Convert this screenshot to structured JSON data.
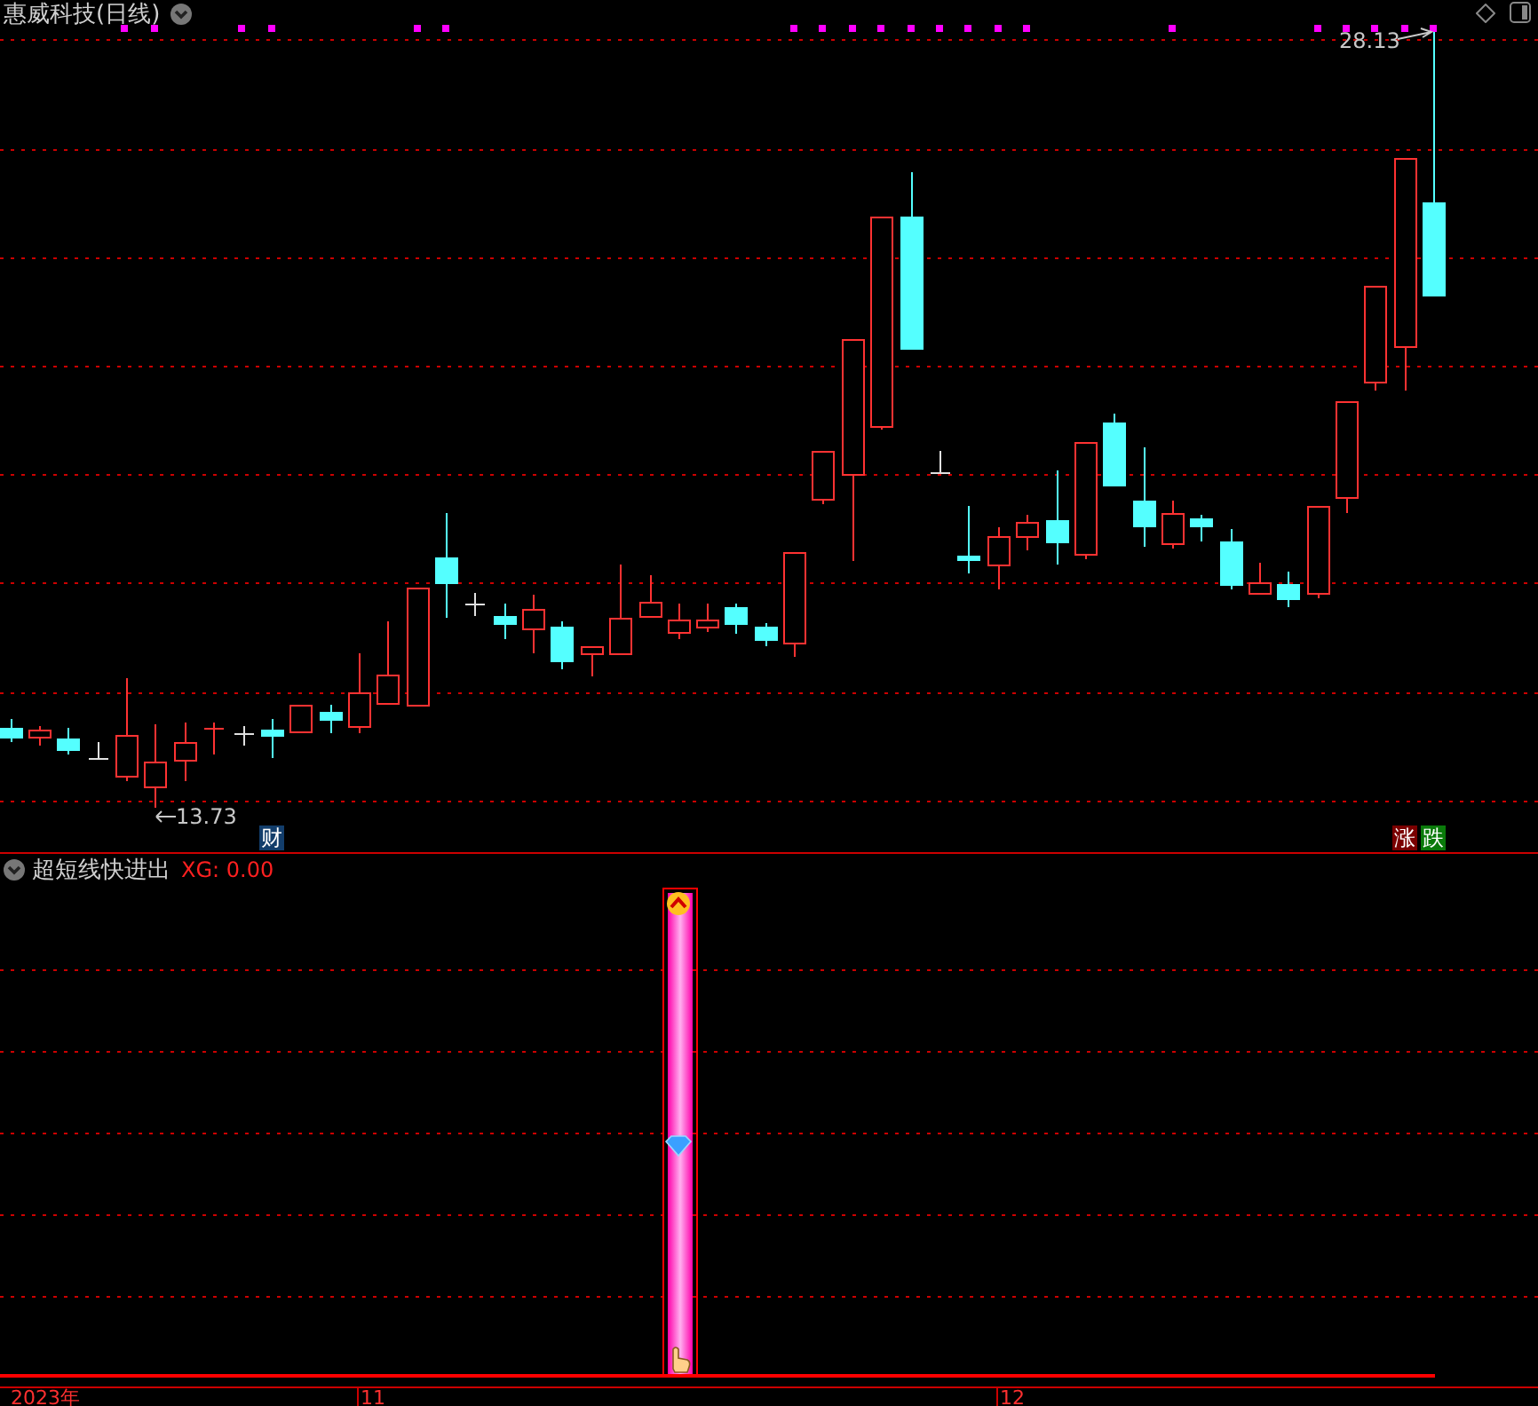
{
  "price_panel": {
    "title": "惠威科技(日线)",
    "high_label": "28.13",
    "low_label": "13.73",
    "badges": [
      {
        "label": "财",
        "color": "#123d6b"
      },
      {
        "label": "涨",
        "color": "#7a0000"
      },
      {
        "label": "跌",
        "color": "#0a7a0a"
      }
    ]
  },
  "indicator_panel": {
    "title": "超短线快进出",
    "reading": "XG: 0.00"
  },
  "time_axis": {
    "labels": [
      "2023年",
      "11",
      "12"
    ]
  }
}
